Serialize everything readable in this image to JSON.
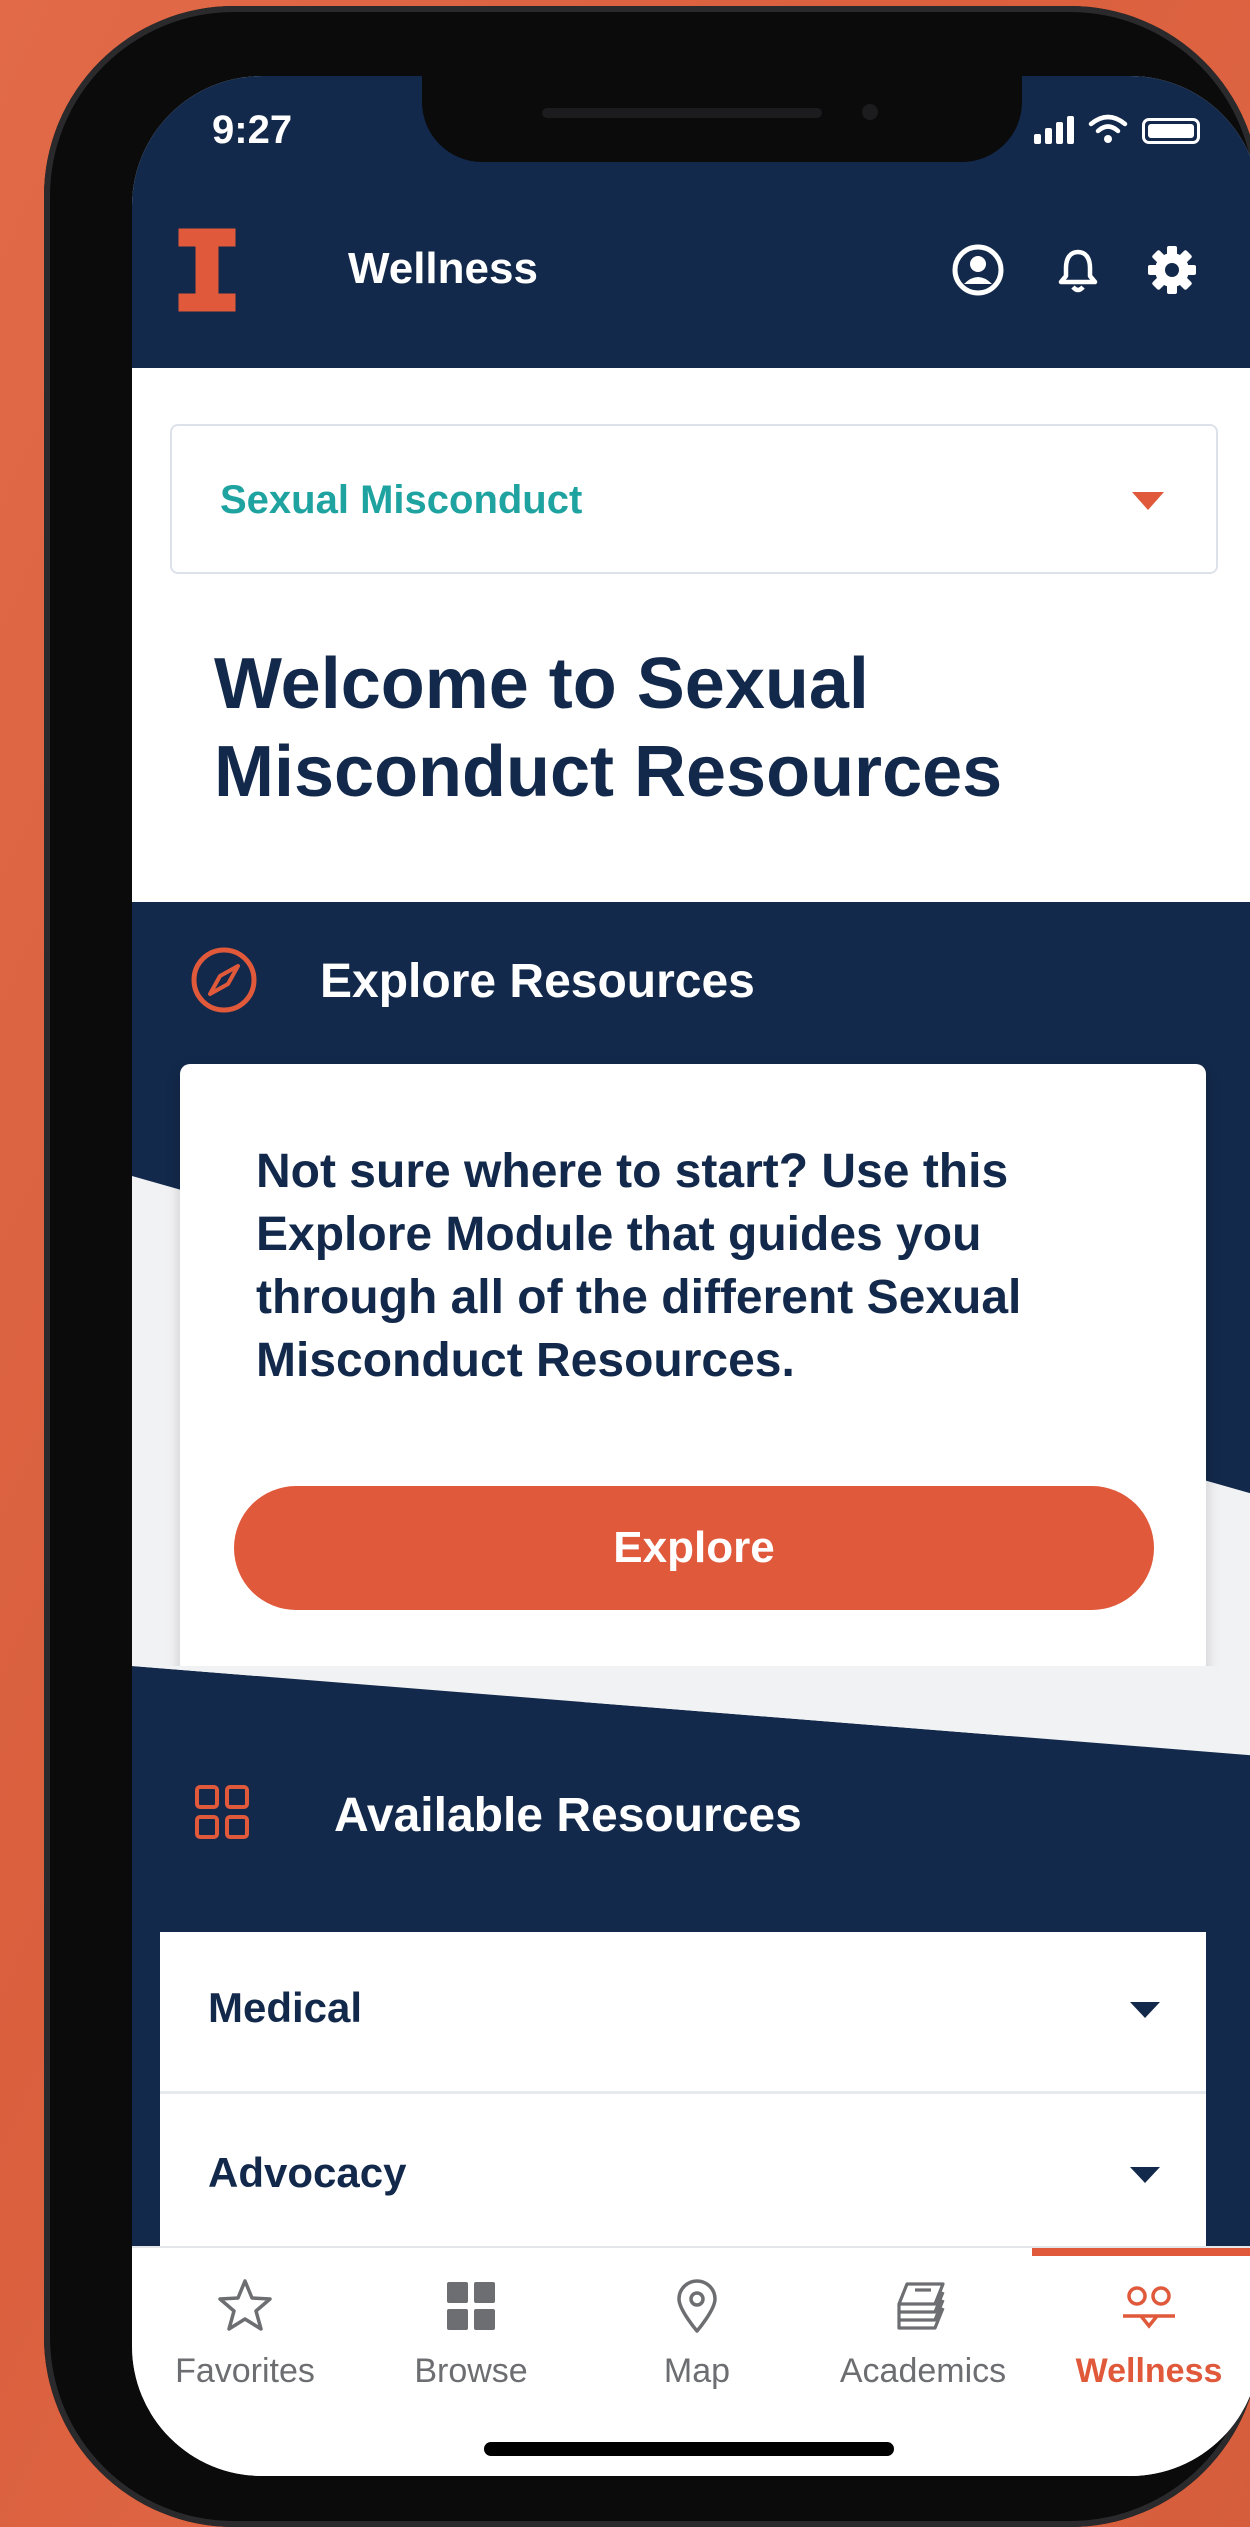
{
  "status_bar": {
    "time": "9:27"
  },
  "header": {
    "title": "Wellness"
  },
  "category_dropdown": {
    "selected": "Sexual Misconduct"
  },
  "welcome": {
    "heading": "Welcome to Sexual Misconduct Resources"
  },
  "explore_section": {
    "title": "Explore Resources",
    "description": "Not sure where to start? Use this Explore Module that guides you through all of the different Sexual Misconduct Resources.",
    "button_label": "Explore"
  },
  "available_section": {
    "title": "Available Resources",
    "items": [
      {
        "label": "Medical"
      },
      {
        "label": "Advocacy"
      }
    ]
  },
  "tab_bar": {
    "tabs": [
      {
        "label": "Favorites",
        "icon": "star-icon"
      },
      {
        "label": "Browse",
        "icon": "grid-icon"
      },
      {
        "label": "Map",
        "icon": "map-pin-icon"
      },
      {
        "label": "Academics",
        "icon": "books-icon"
      },
      {
        "label": "Wellness",
        "icon": "people-icon",
        "active": true
      }
    ]
  },
  "colors": {
    "navy": "#13294b",
    "orange": "#e0593b",
    "teal": "#1ea3a0",
    "background": "#e0623f"
  }
}
